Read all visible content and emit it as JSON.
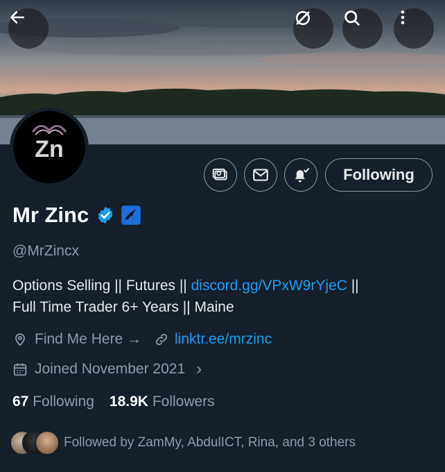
{
  "banner": {
    "back_icon": "arrow-left-icon",
    "grok_icon": "grok-slash-icon",
    "search_icon": "search-icon",
    "more_icon": "more-vertical-icon"
  },
  "avatar": {
    "monogram": "Zn"
  },
  "actions": {
    "subscribe_icon": "money-icon",
    "message_icon": "envelope-icon",
    "notify_icon": "bell-check-icon",
    "following_label": "Following"
  },
  "profile": {
    "display_name": "Mr Zinc",
    "handle": "@MrZincx",
    "bio_part1": "Options Selling || Futures || ",
    "bio_link": "discord.gg/VPxW9rYjeC",
    "bio_part2": " ||",
    "bio_line2": "Full Time Trader 6+ Years || Maine",
    "location": "Find Me Here →",
    "website": "linktr.ee/mrzinc",
    "joined": "Joined November 2021",
    "chevron": "›"
  },
  "stats": {
    "following_count": "67",
    "following_label": "Following",
    "followers_count": "18.9K",
    "followers_label": "Followers"
  },
  "followed_by": "Followed by ZamMy, AbdulICT, Rina, and 3 others",
  "colors": {
    "accent": "#1d9bf0",
    "background": "#15202b",
    "muted": "#8b98a5",
    "verified": "#1d9bf0"
  }
}
